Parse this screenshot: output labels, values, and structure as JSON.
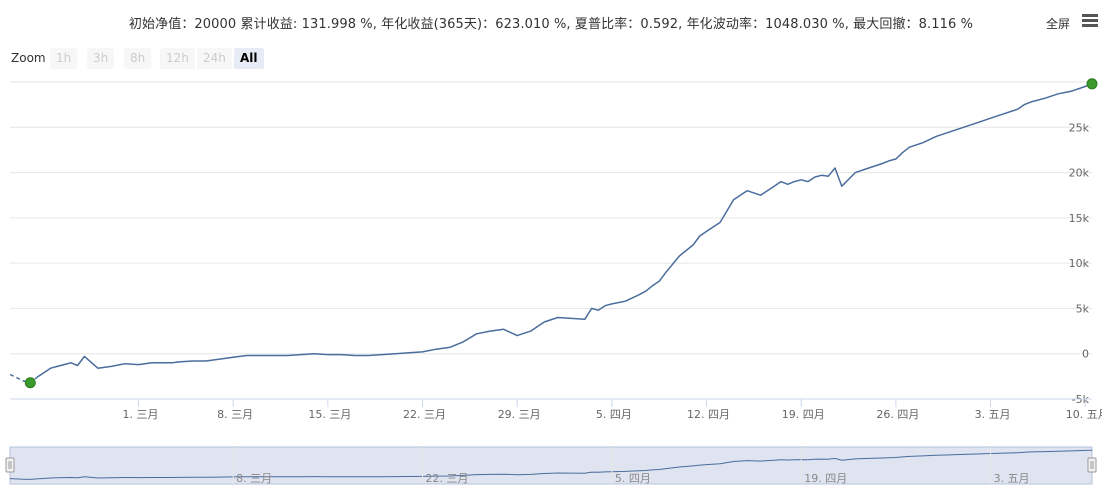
{
  "header": {
    "title": "初始净值：20000 累计收益: 131.998 %, 年化收益(365天)：623.010 %, 夏普比率：0.592, 年化波动率：1048.030 %, 最大回撤：8.116 %",
    "fullscreen_label": "全屏"
  },
  "zoom": {
    "label": "Zoom",
    "buttons": [
      "1h",
      "3h",
      "8h",
      "12h",
      "24h",
      "All"
    ],
    "active": "All"
  },
  "colors": {
    "line": "#4a6d9c",
    "marker": "#3a9a2a",
    "navigator_fill": "#d4dbeb",
    "grid": "#e6e6e6"
  },
  "chart_data": {
    "type": "line",
    "y_ticks": [
      "-5k",
      "0",
      "5k",
      "10k",
      "15k",
      "20k",
      "25k"
    ],
    "y_tick_values": [
      -5000,
      0,
      5000,
      10000,
      15000,
      20000,
      25000
    ],
    "ylim": [
      -5000,
      30000
    ],
    "x_ticks": [
      "1. 三月",
      "8. 三月",
      "15. 三月",
      "22. 三月",
      "29. 三月",
      "5. 四月",
      "12. 四月",
      "19. 四月",
      "26. 四月",
      "3. 五月",
      "10. 五月"
    ],
    "xlim_days": [
      -9.5,
      70.5
    ],
    "navigator_ticks": [
      "8. 三月",
      "22. 三月",
      "5. 四月",
      "19. 四月",
      "3. 五月"
    ],
    "navigator_tick_days": [
      7,
      21,
      35,
      49,
      63
    ],
    "series": [
      {
        "x": [
          -9.5,
          -8.5,
          -8,
          -7.5,
          -6.5,
          -6,
          -5.5,
          -5,
          -4.5,
          -4,
          -3,
          -2,
          -1,
          0,
          1,
          2,
          2.5,
          3,
          4,
          5,
          6,
          7,
          8,
          9,
          10,
          11,
          12,
          13,
          14,
          15,
          16,
          17,
          18,
          19,
          20,
          21,
          22,
          23,
          24,
          25,
          26,
          27,
          28,
          29,
          30,
          31,
          32,
          33,
          33.5,
          34,
          34.5,
          35,
          36,
          37,
          37.5,
          38,
          38.5,
          39,
          40,
          41,
          41.5,
          42,
          43,
          44,
          45,
          46,
          46.5,
          47,
          47.5,
          48,
          48.5,
          49,
          49.5,
          50,
          50.5,
          51,
          51.5,
          52,
          53,
          54,
          55,
          55.5,
          56,
          56.5,
          57,
          58,
          59,
          60,
          61,
          62,
          63,
          64,
          65,
          65.5,
          66,
          67,
          68,
          69,
          70,
          70.5
        ],
        "y": [
          -2300,
          -3000,
          -3200,
          -2600,
          -1600,
          -1400,
          -1200,
          -1000,
          -1300,
          -300,
          -1600,
          -1400,
          -1100,
          -1200,
          -1000,
          -1000,
          -1000,
          -900,
          -800,
          -800,
          -600,
          -400,
          -200,
          -200,
          -200,
          -200,
          -100,
          0,
          -100,
          -100,
          -200,
          -200,
          -100,
          0,
          100,
          200,
          500,
          700,
          1300,
          2200,
          2500,
          2700,
          2000,
          2500,
          3500,
          4000,
          3900,
          3800,
          5000,
          4800,
          5300,
          5500,
          5800,
          6500,
          6900,
          7500,
          8000,
          9000,
          10800,
          12000,
          13000,
          13500,
          14500,
          17000,
          18000,
          17500,
          18000,
          18500,
          19000,
          18700,
          19000,
          19200,
          19000,
          19500,
          19700,
          19600,
          20500,
          18500,
          20000,
          20500,
          21000,
          21300,
          21500,
          22200,
          22800,
          23300,
          24000,
          24500,
          25000,
          25500,
          26000,
          26500,
          27000,
          27500,
          27800,
          28200,
          28700,
          29000,
          29500,
          29800
        ]
      }
    ]
  }
}
